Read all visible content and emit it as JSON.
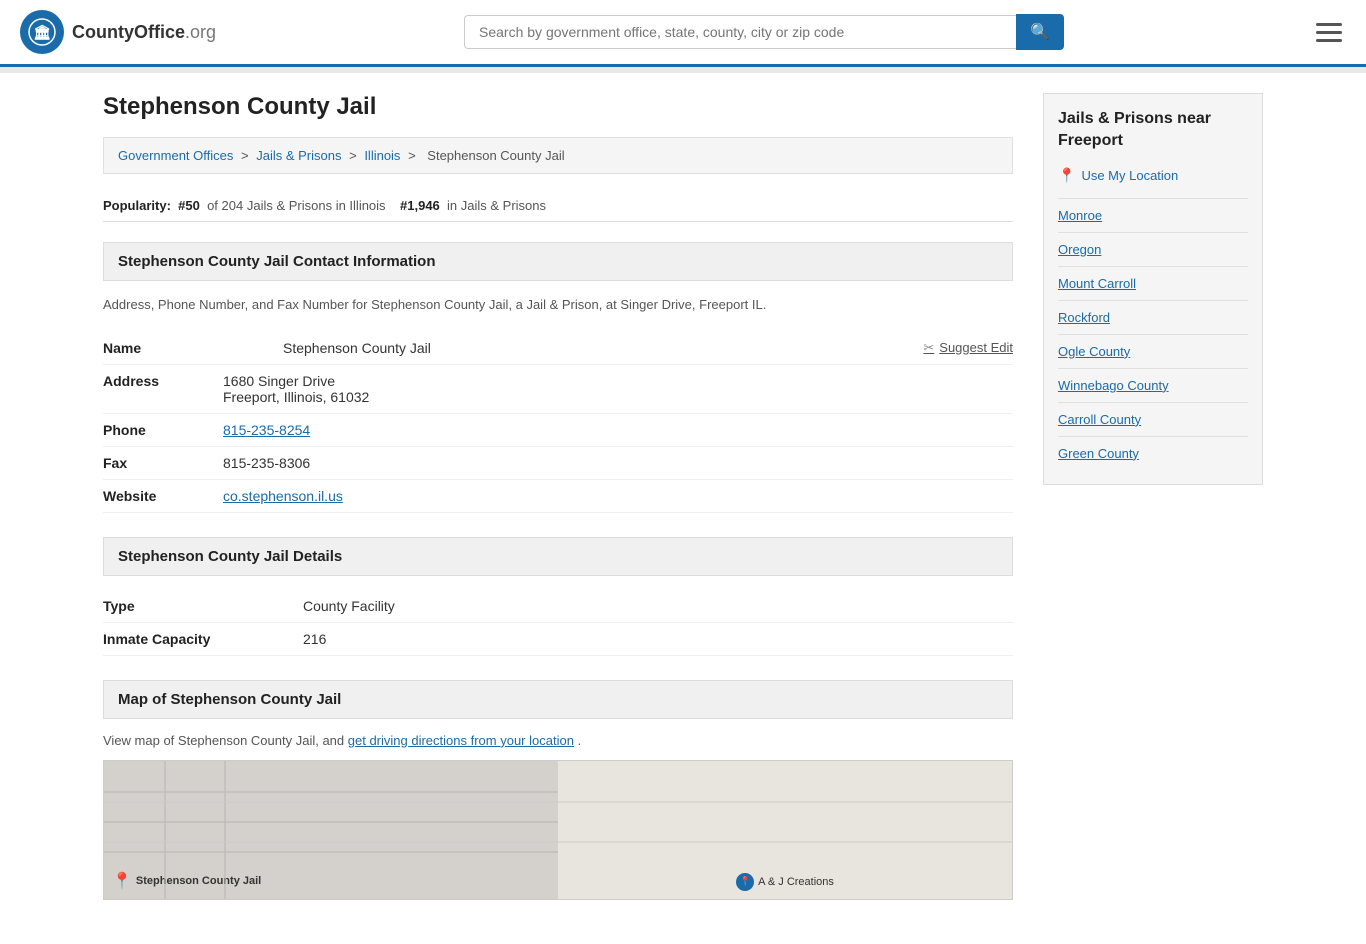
{
  "header": {
    "logo_icon": "🏛",
    "logo_name": "CountyOffice",
    "logo_org": ".org",
    "search_placeholder": "Search by government office, state, county, city or zip code",
    "search_icon": "🔍"
  },
  "page": {
    "title": "Stephenson County Jail"
  },
  "breadcrumb": {
    "items": [
      "Government Offices",
      "Jails & Prisons",
      "Illinois",
      "Stephenson County Jail"
    ],
    "separator": ">"
  },
  "popularity": {
    "label": "Popularity:",
    "rank": "#50",
    "total": "of 204 Jails & Prisons in Illinois",
    "national_rank": "#1,946",
    "national_label": "in Jails & Prisons"
  },
  "contact": {
    "section_title": "Stephenson County Jail Contact Information",
    "description": "Address, Phone Number, and Fax Number for Stephenson County Jail, a Jail & Prison, at Singer Drive, Freeport IL.",
    "name_label": "Name",
    "name_value": "Stephenson County Jail",
    "suggest_edit": "Suggest Edit",
    "address_label": "Address",
    "address_line1": "1680 Singer Drive",
    "address_line2": "Freeport, Illinois, 61032",
    "phone_label": "Phone",
    "phone_value": "815-235-8254",
    "fax_label": "Fax",
    "fax_value": "815-235-8306",
    "website_label": "Website",
    "website_value": "co.stephenson.il.us"
  },
  "details": {
    "section_title": "Stephenson County Jail Details",
    "type_label": "Type",
    "type_value": "County Facility",
    "capacity_label": "Inmate Capacity",
    "capacity_value": "216"
  },
  "map": {
    "section_title": "Map of Stephenson County Jail",
    "description": "View map of Stephenson County Jail, and",
    "directions_link": "get driving directions from your location",
    "period": ".",
    "pin_label": "Stephenson County Jail",
    "biz_label": "A & J Creations"
  },
  "sidebar": {
    "title": "Jails & Prisons near Freeport",
    "use_location": "Use My Location",
    "links": [
      "Monroe",
      "Oregon",
      "Mount Carroll",
      "Rockford",
      "Ogle County",
      "Winnebago County",
      "Carroll County",
      "Green County"
    ]
  }
}
